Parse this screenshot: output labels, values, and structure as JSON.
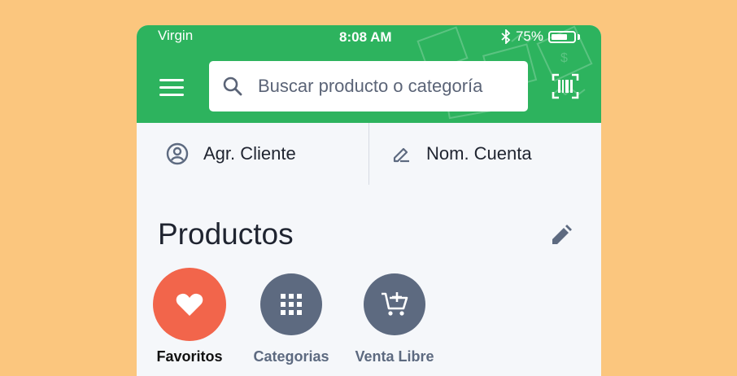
{
  "status_bar": {
    "carrier": "Virgin",
    "time": "8:08 AM",
    "battery_percent": "75%",
    "battery_level": 0.75
  },
  "search": {
    "placeholder": "Buscar producto o categoría"
  },
  "actions": {
    "add_client": "Agr. Cliente",
    "account_name": "Nom. Cuenta"
  },
  "products": {
    "title": "Productos",
    "categories": [
      {
        "label": "Favoritos",
        "icon": "heart-icon"
      },
      {
        "label": "Categorias",
        "icon": "grid-icon"
      },
      {
        "label": "Venta Libre",
        "icon": "cart-plus-icon"
      }
    ]
  },
  "colors": {
    "brand_green": "#2DB35E",
    "background": "#FBC67E",
    "favorite_red": "#F2654B",
    "icon_gray": "#5D6A80"
  }
}
